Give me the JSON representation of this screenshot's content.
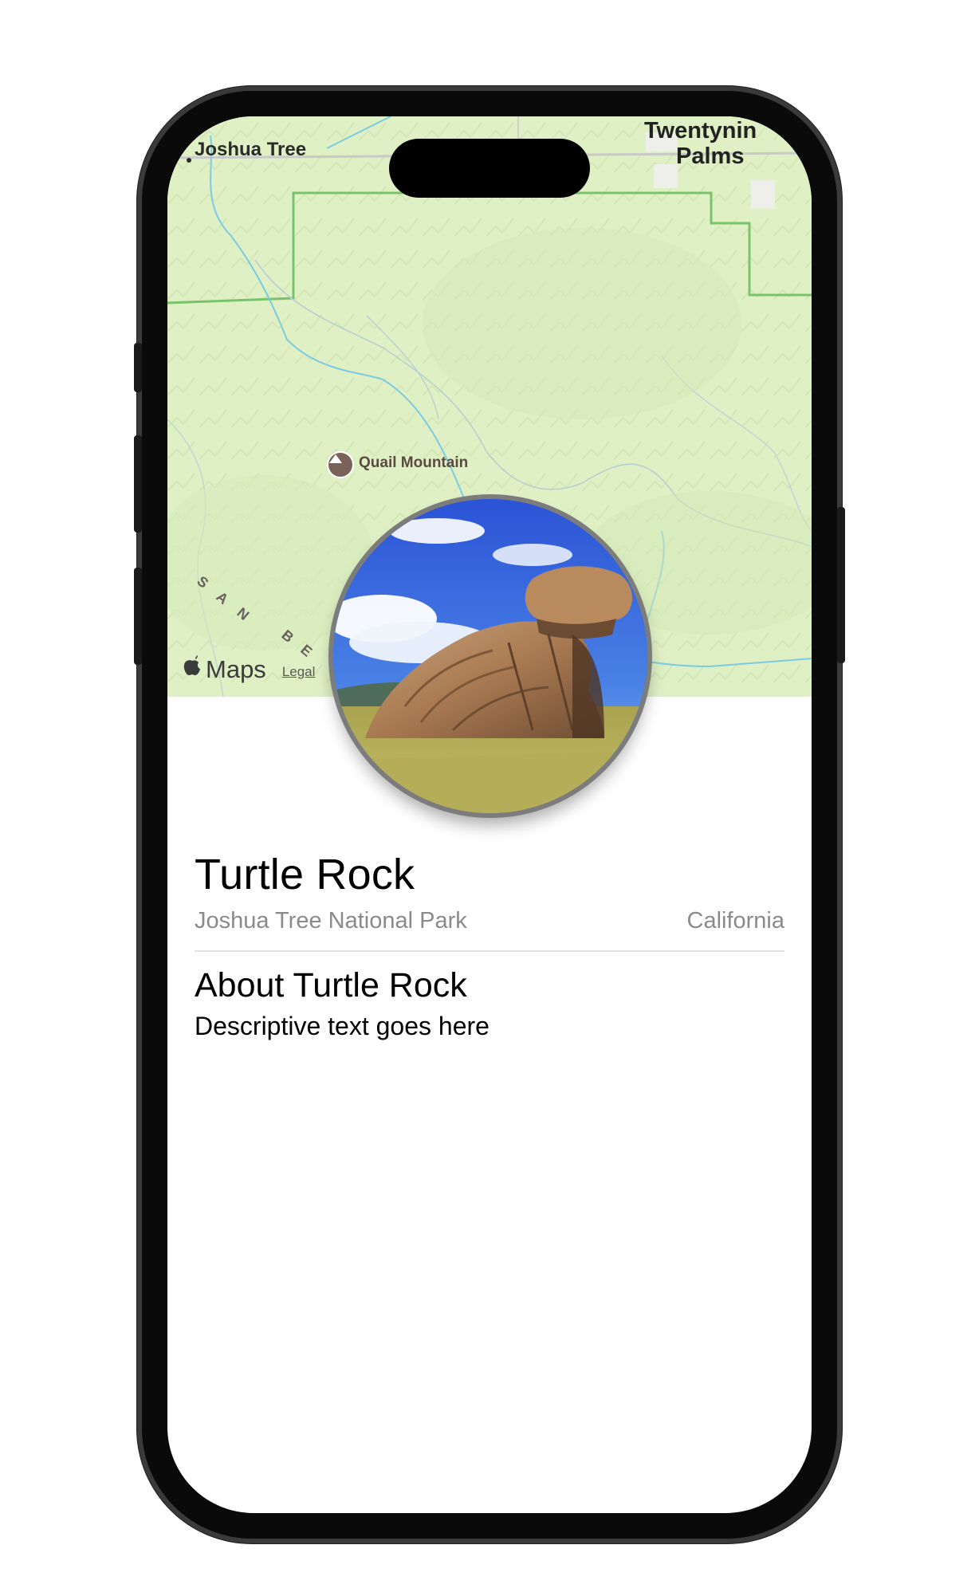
{
  "map": {
    "labels": {
      "joshua_tree": "Joshua Tree",
      "twentynine_palms_line1": "Twentynin",
      "twentynine_palms_line2": "Palms",
      "quail_mountain": "Quail Mountain",
      "range_letters": [
        "S",
        "A",
        "N",
        "B",
        "E"
      ]
    },
    "attribution": {
      "brand": "Maps",
      "legal": "Legal"
    },
    "colors": {
      "land": "#dff0c4",
      "park_border": "#7cc46a",
      "water": "#74c6e0",
      "road": "#c8c8c8"
    }
  },
  "landmark": {
    "name": "Turtle Rock",
    "park": "Joshua Tree National Park",
    "state": "California",
    "about_title": "About Turtle Rock",
    "description": "Descriptive text goes here"
  },
  "icons": {
    "mountain": "mountain-peak-icon",
    "apple": "apple-logo-icon"
  }
}
